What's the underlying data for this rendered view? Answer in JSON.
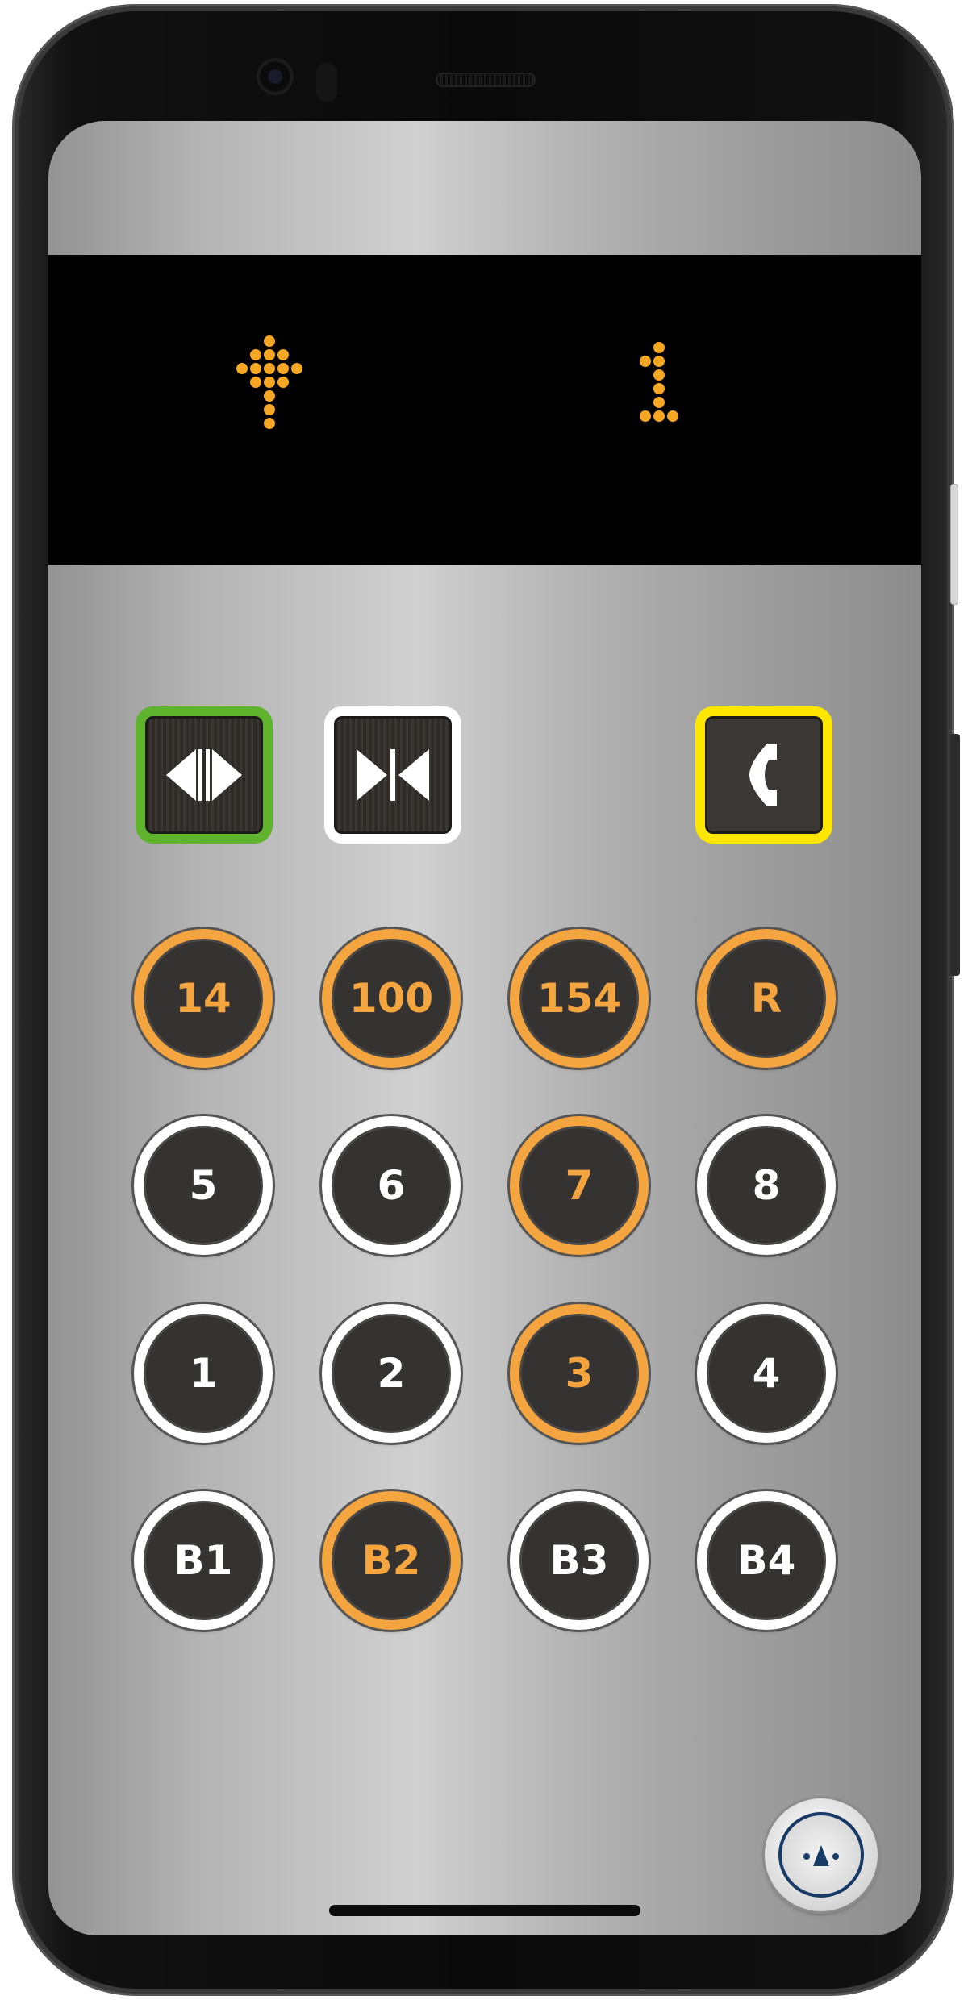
{
  "display": {
    "direction": "up",
    "floor": "1",
    "led_color": "#f5a623"
  },
  "controls": [
    {
      "name": "door-open",
      "icon": "door-open-icon",
      "border_color": "#5fb32d"
    },
    {
      "name": "door-close",
      "icon": "door-close-icon",
      "border_color": "#ffffff"
    },
    {
      "name": "emergency-call",
      "icon": "phone-icon",
      "border_color": "#ffe600"
    }
  ],
  "floors": [
    {
      "label": "14",
      "lit": true
    },
    {
      "label": "100",
      "lit": true
    },
    {
      "label": "154",
      "lit": true
    },
    {
      "label": "R",
      "lit": true
    },
    {
      "label": "5",
      "lit": false
    },
    {
      "label": "6",
      "lit": false
    },
    {
      "label": "7",
      "lit": true
    },
    {
      "label": "8",
      "lit": false
    },
    {
      "label": "1",
      "lit": false
    },
    {
      "label": "2",
      "lit": false
    },
    {
      "label": "3",
      "lit": true
    },
    {
      "label": "4",
      "lit": false
    },
    {
      "label": "B1",
      "lit": false
    },
    {
      "label": "B2",
      "lit": true
    },
    {
      "label": "B3",
      "lit": false
    },
    {
      "label": "B4",
      "lit": false
    }
  ],
  "colors": {
    "lit": "#f5a540",
    "unlit_ring": "#ffffff",
    "button_face": "#353331"
  },
  "assist_icon": "accessibility-icon"
}
